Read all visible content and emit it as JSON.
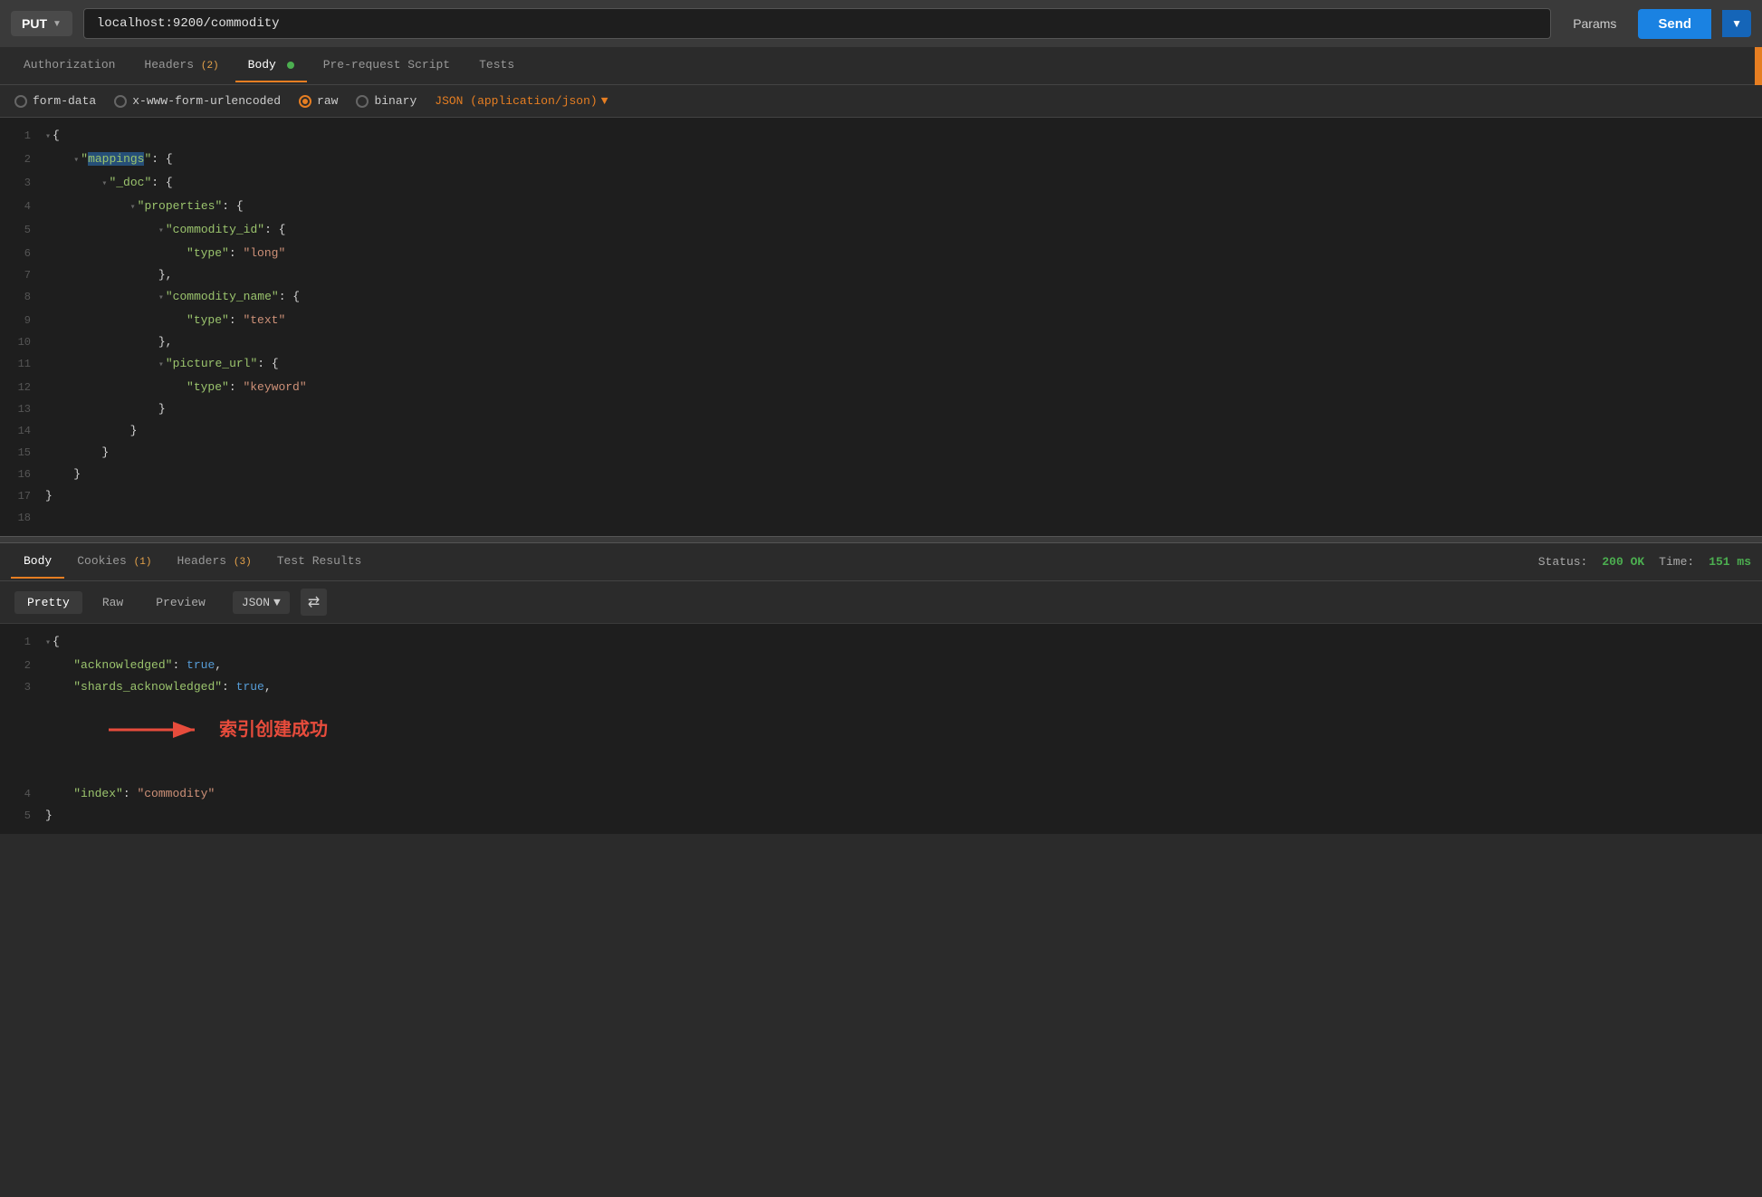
{
  "topbar": {
    "method": "PUT",
    "url": "localhost:9200/commodity",
    "params_label": "Params",
    "send_label": "Send"
  },
  "request_tabs": {
    "items": [
      {
        "id": "authorization",
        "label": "Authorization",
        "active": false,
        "badge": null
      },
      {
        "id": "headers",
        "label": "Headers",
        "active": false,
        "badge": "(2)"
      },
      {
        "id": "body",
        "label": "Body",
        "active": true,
        "badge": null,
        "dot": true
      },
      {
        "id": "prerequest",
        "label": "Pre-request Script",
        "active": false,
        "badge": null
      },
      {
        "id": "tests",
        "label": "Tests",
        "active": false,
        "badge": null
      }
    ]
  },
  "body_options": {
    "form_data": "form-data",
    "urlencoded": "x-www-form-urlencoded",
    "raw": "raw",
    "binary": "binary",
    "json_type": "JSON (application/json)"
  },
  "request_body": {
    "lines": [
      {
        "num": 1,
        "content": "{",
        "indent": 0
      },
      {
        "num": 2,
        "content": "    \"mappings\": {",
        "indent": 1,
        "highlight": "mappings"
      },
      {
        "num": 3,
        "content": "        \"_doc\": {",
        "indent": 2
      },
      {
        "num": 4,
        "content": "            \"properties\": {",
        "indent": 3
      },
      {
        "num": 5,
        "content": "                \"commodity_id\": {",
        "indent": 4
      },
      {
        "num": 6,
        "content": "                    \"type\": \"long\"",
        "indent": 5
      },
      {
        "num": 7,
        "content": "                },",
        "indent": 4
      },
      {
        "num": 8,
        "content": "                \"commodity_name\": {",
        "indent": 4
      },
      {
        "num": 9,
        "content": "                    \"type\": \"text\"",
        "indent": 5
      },
      {
        "num": 10,
        "content": "                },",
        "indent": 4
      },
      {
        "num": 11,
        "content": "                \"picture_url\": {",
        "indent": 4
      },
      {
        "num": 12,
        "content": "                    \"type\": \"keyword\"",
        "indent": 5
      },
      {
        "num": 13,
        "content": "                }",
        "indent": 4
      },
      {
        "num": 14,
        "content": "            }",
        "indent": 3
      },
      {
        "num": 15,
        "content": "        }",
        "indent": 2
      },
      {
        "num": 16,
        "content": "    }",
        "indent": 1
      },
      {
        "num": 17,
        "content": "}",
        "indent": 0
      },
      {
        "num": 18,
        "content": "",
        "indent": 0
      }
    ]
  },
  "response_tabs": {
    "items": [
      {
        "id": "body",
        "label": "Body",
        "active": true,
        "badge": null
      },
      {
        "id": "cookies",
        "label": "Cookies",
        "active": false,
        "badge": "(1)"
      },
      {
        "id": "headers",
        "label": "Headers",
        "active": false,
        "badge": "(3)"
      },
      {
        "id": "test_results",
        "label": "Test Results",
        "active": false,
        "badge": null
      }
    ],
    "status_label": "Status:",
    "status_value": "200 OK",
    "time_label": "Time:",
    "time_value": "151 ms"
  },
  "response_options": {
    "pretty": "Pretty",
    "raw": "Raw",
    "preview": "Preview",
    "json": "JSON"
  },
  "response_body": {
    "lines": [
      {
        "num": 1,
        "content": "{"
      },
      {
        "num": 2,
        "content": "    \"acknowledged\": true,"
      },
      {
        "num": 3,
        "content": "    \"shards_acknowledged\": true,"
      },
      {
        "num": 4,
        "content": "    \"index\": \"commodity\""
      },
      {
        "num": 5,
        "content": "}"
      }
    ]
  },
  "annotation": {
    "text": "索引创建成功"
  }
}
